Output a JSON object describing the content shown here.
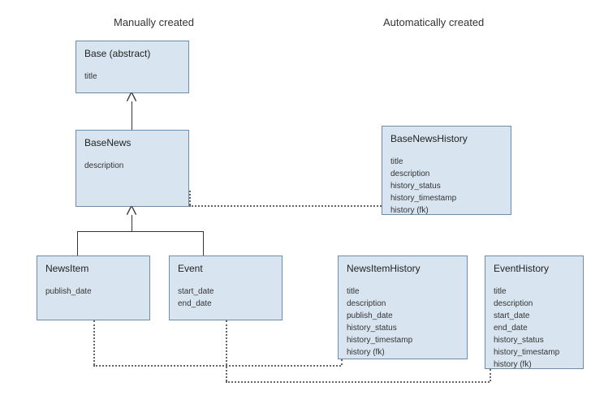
{
  "labels": {
    "manual": "Manually created",
    "auto": "Automatically created"
  },
  "boxes": {
    "base": {
      "title": "Base (abstract)",
      "fields": [
        "title"
      ]
    },
    "baseNews": {
      "title": "BaseNews",
      "fields": [
        "description"
      ]
    },
    "newsItem": {
      "title": "NewsItem",
      "fields": [
        "publish_date"
      ]
    },
    "event": {
      "title": "Event",
      "fields": [
        "start_date",
        "end_date"
      ]
    },
    "baseNewsHistory": {
      "title": "BaseNewsHistory",
      "fields": [
        "title",
        "description",
        "history_status",
        "history_timestamp",
        "history (fk)"
      ]
    },
    "newsItemHistory": {
      "title": "NewsItemHistory",
      "fields": [
        "title",
        "description",
        "publish_date",
        "history_status",
        "history_timestamp",
        "history (fk)"
      ]
    },
    "eventHistory": {
      "title": "EventHistory",
      "fields": [
        "title",
        "description",
        "start_date",
        "end_date",
        "history_status",
        "history_timestamp",
        "history (fk)"
      ]
    }
  }
}
